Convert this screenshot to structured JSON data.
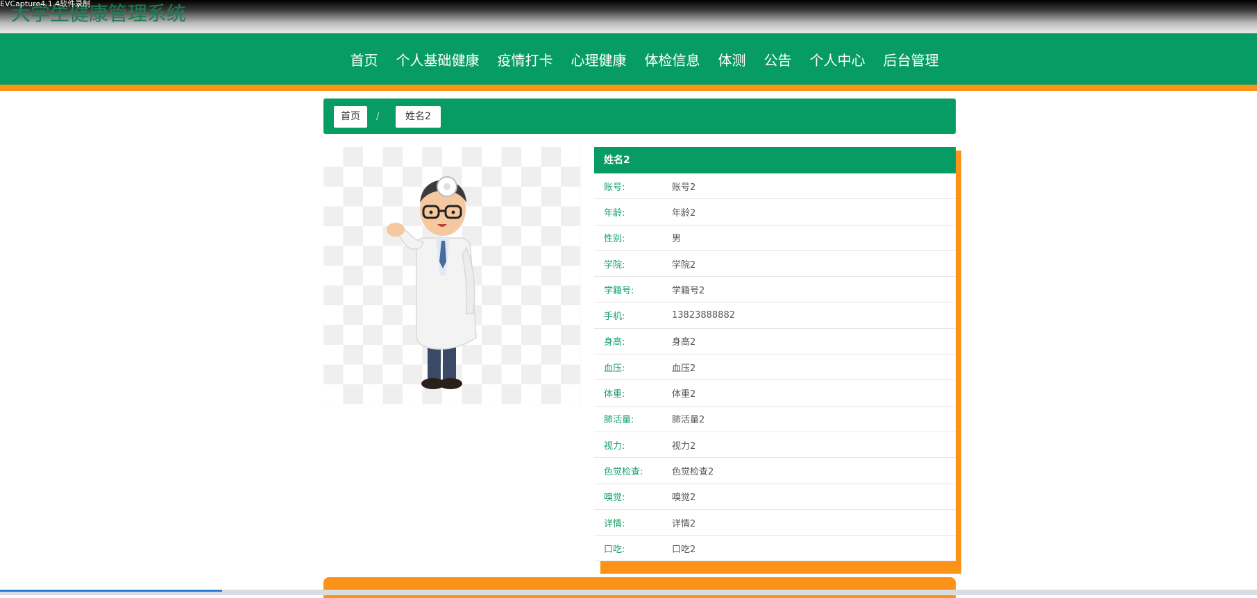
{
  "capture_label": "EVCapture4.1.4软件录制",
  "site_title": "大学生健康管理系统",
  "nav": [
    "首页",
    "个人基础健康",
    "疫情打卡",
    "心理健康",
    "体检信息",
    "体测",
    "公告",
    "个人中心",
    "后台管理"
  ],
  "breadcrumb": {
    "home": "首页",
    "separator": "/",
    "current": "姓名2"
  },
  "detail": {
    "title": "姓名2",
    "rows": [
      {
        "k": "账号:",
        "v": "账号2"
      },
      {
        "k": "年龄:",
        "v": "年龄2"
      },
      {
        "k": "性别:",
        "v": "男"
      },
      {
        "k": "学院:",
        "v": "学院2"
      },
      {
        "k": "学籍号:",
        "v": "学籍号2"
      },
      {
        "k": "手机:",
        "v": "13823888882"
      },
      {
        "k": "身高:",
        "v": "身高2"
      },
      {
        "k": "血压:",
        "v": "血压2"
      },
      {
        "k": "体重:",
        "v": "体重2"
      },
      {
        "k": "肺活量:",
        "v": "肺活量2"
      },
      {
        "k": "视力:",
        "v": "视力2"
      },
      {
        "k": "色觉检查:",
        "v": "色觉检查2"
      },
      {
        "k": "嗅觉:",
        "v": "嗅觉2"
      },
      {
        "k": "详情:",
        "v": "详情2"
      },
      {
        "k": "口吃:",
        "v": "口吃2"
      }
    ]
  },
  "colors": {
    "primary": "#089c65",
    "accent": "#fa9317",
    "label": "#16a069"
  }
}
